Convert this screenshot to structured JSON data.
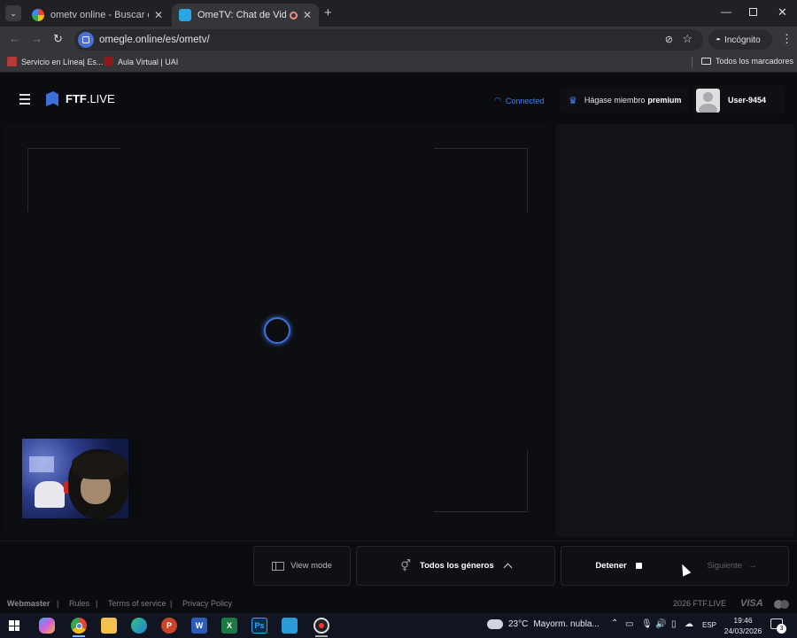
{
  "browser": {
    "tabs": [
      {
        "title": "ometv online - Buscar con Goo",
        "active": false
      },
      {
        "title": "OmeTV: Chat de Video - Alt",
        "active": true
      }
    ],
    "new_tab": "+",
    "url": "omegle.online/es/ometv/",
    "incognito_label": "Incógnito",
    "bookmarks": [
      "Servicio en Línea| Es...",
      "Aula Virtual | UAI"
    ],
    "all_bookmarks": "Todos los marcadores"
  },
  "site": {
    "logo_bold": "FTF",
    "logo_rest": ".LIVE",
    "status": "Connected",
    "premium_prefix": "Hágase miembro",
    "premium_bold": "premium",
    "username": "User-9454"
  },
  "controls": {
    "view_mode": "View mode",
    "genders": "Todos los géneros",
    "stop": "Detener",
    "next": "Siguiente"
  },
  "footer": {
    "links": [
      "Webmaster",
      "Rules",
      "Terms of service",
      "Privacy Policy"
    ],
    "separator": "|",
    "copyright": "2026 FTF.LIVE",
    "visa": "VISA"
  },
  "taskbar": {
    "weather": "23°C",
    "weather_desc": "Mayorm. nubla...",
    "lang": "ESP",
    "time": "19:46",
    "date": "24/03/2026",
    "notif_count": "3"
  },
  "colors": {
    "accent_blue": "#4a86f7",
    "connected": "#3b82f6",
    "chrome_dark": "#202124"
  }
}
